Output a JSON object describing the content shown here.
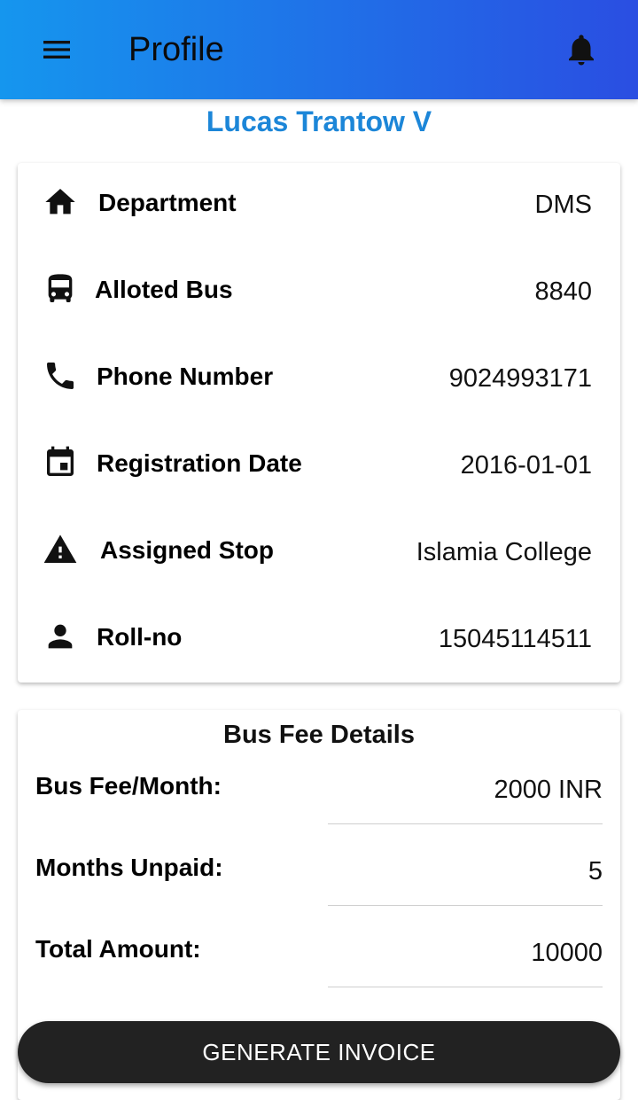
{
  "appbar": {
    "title": "Profile",
    "menu_icon": "menu-icon",
    "notification_icon": "bell-icon",
    "gradient_start": "#1596ee",
    "gradient_end": "#2a4ee2"
  },
  "profile": {
    "name": "Lucas Trantow V",
    "name_color": "#1c86d8"
  },
  "info": [
    {
      "icon": "home-icon",
      "label": "Department",
      "value": "DMS"
    },
    {
      "icon": "bus-icon",
      "label": "Alloted Bus",
      "value": "8840"
    },
    {
      "icon": "phone-icon",
      "label": "Phone Number",
      "value": "9024993171"
    },
    {
      "icon": "calendar-icon",
      "label": "Registration Date",
      "value": "2016-01-01"
    },
    {
      "icon": "warning-icon",
      "label": "Assigned Stop",
      "value": "Islamia College"
    },
    {
      "icon": "person-icon",
      "label": "Roll-no",
      "value": "15045114511"
    }
  ],
  "fees": {
    "title": "Bus Fee Details",
    "rows": [
      {
        "label": "Bus Fee/Month:",
        "value": "2000 INR"
      },
      {
        "label": "Months Unpaid:",
        "value": "5"
      },
      {
        "label": "Total Amount:",
        "value": "10000"
      }
    ]
  },
  "actions": {
    "generate_invoice": "GENERATE INVOICE",
    "button_color": "#222222"
  }
}
